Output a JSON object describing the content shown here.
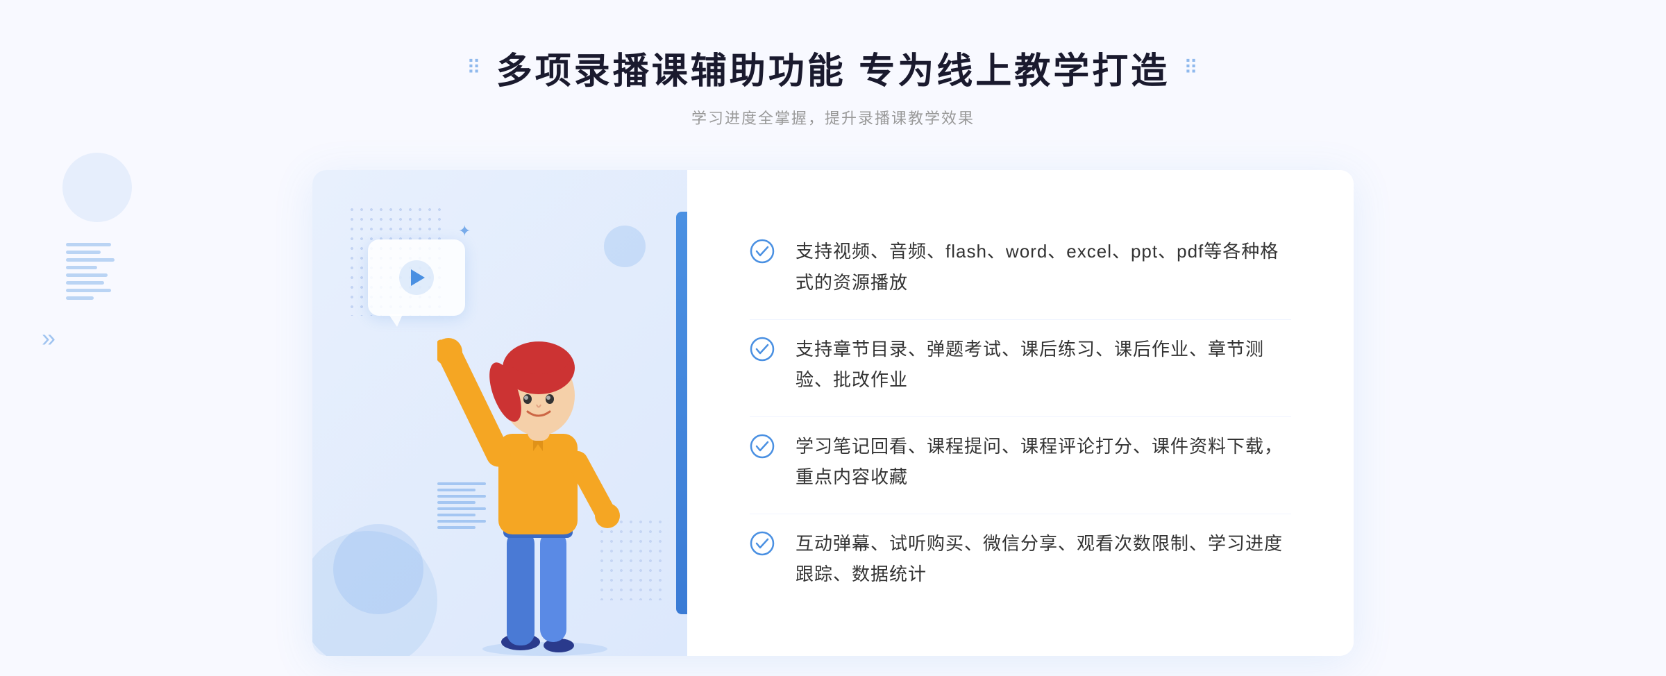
{
  "page": {
    "background": "#f8f9ff"
  },
  "header": {
    "title": "多项录播课辅助功能 专为线上教学打造",
    "subtitle": "学习进度全掌握，提升录播课教学效果",
    "dots_left": "⠿",
    "dots_right": "⠿"
  },
  "features": [
    {
      "id": 1,
      "text": "支持视频、音频、flash、word、excel、ppt、pdf等各种格式的资源播放"
    },
    {
      "id": 2,
      "text": "支持章节目录、弹题考试、课后练习、课后作业、章节测验、批改作业"
    },
    {
      "id": 3,
      "text": "学习笔记回看、课程提问、课程评论打分、课件资料下载，重点内容收藏"
    },
    {
      "id": 4,
      "text": "互动弹幕、试听购买、微信分享、观看次数限制、学习进度跟踪、数据统计"
    }
  ],
  "colors": {
    "primary": "#4a90e2",
    "title": "#1a1a2e",
    "subtitle": "#999999",
    "feature_text": "#333333",
    "check_color": "#4a90e2"
  },
  "icons": {
    "play": "▶",
    "chevron": "»",
    "spark": "✦"
  }
}
